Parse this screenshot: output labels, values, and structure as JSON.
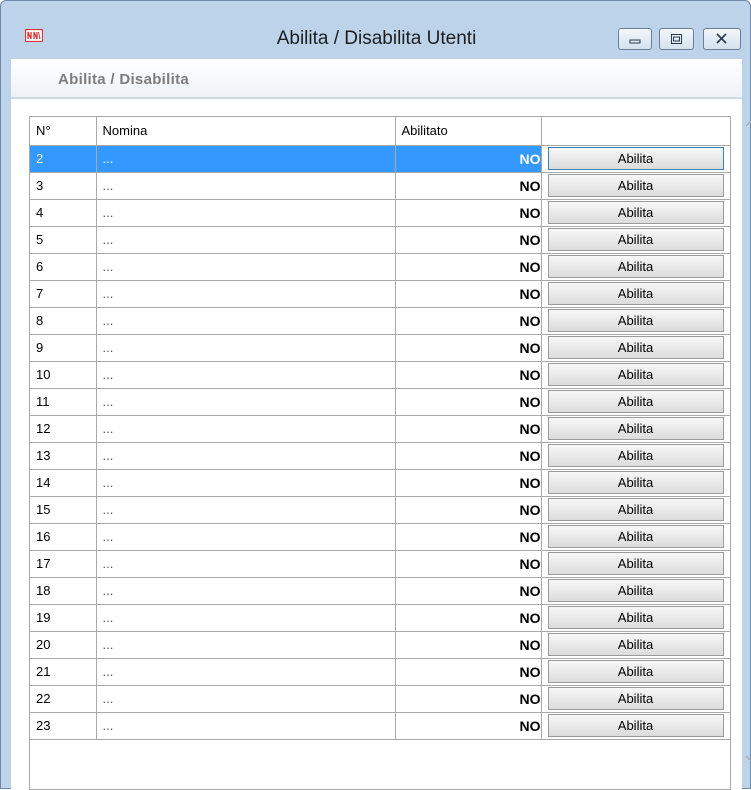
{
  "window": {
    "title": "Abilita / Disabilita Utenti",
    "app_icon": "nn-app-icon",
    "controls": [
      "minimize-icon",
      "restore-icon",
      "close-icon"
    ]
  },
  "section": {
    "title": "Abilita / Disabilita"
  },
  "table": {
    "columns": [
      "N°",
      "Nomina",
      "Abilitato",
      ""
    ],
    "selected_row": 0,
    "rows": [
      {
        "n": "2",
        "nome": "...",
        "abilitato": "NO",
        "azione": "Abilita"
      },
      {
        "n": "3",
        "nome": "...",
        "abilitato": "NO",
        "azione": "Abilita"
      },
      {
        "n": "4",
        "nome": "...",
        "abilitato": "NO",
        "azione": "Abilita"
      },
      {
        "n": "5",
        "nome": "...",
        "abilitato": "NO",
        "azione": "Abilita"
      },
      {
        "n": "6",
        "nome": "...",
        "abilitato": "NO",
        "azione": "Abilita"
      },
      {
        "n": "7",
        "nome": "...",
        "abilitato": "NO",
        "azione": "Abilita"
      },
      {
        "n": "8",
        "nome": "...",
        "abilitato": "NO",
        "azione": "Abilita"
      },
      {
        "n": "9",
        "nome": "...",
        "abilitato": "NO",
        "azione": "Abilita"
      },
      {
        "n": "10",
        "nome": "...",
        "abilitato": "NO",
        "azione": "Abilita"
      },
      {
        "n": "11",
        "nome": "...",
        "abilitato": "NO",
        "azione": "Abilita"
      },
      {
        "n": "12",
        "nome": "...",
        "abilitato": "NO",
        "azione": "Abilita"
      },
      {
        "n": "13",
        "nome": "...",
        "abilitato": "NO",
        "azione": "Abilita"
      },
      {
        "n": "14",
        "nome": "...",
        "abilitato": "NO",
        "azione": "Abilita"
      },
      {
        "n": "15",
        "nome": "...",
        "abilitato": "NO",
        "azione": "Abilita"
      },
      {
        "n": "16",
        "nome": "...",
        "abilitato": "NO",
        "azione": "Abilita"
      },
      {
        "n": "17",
        "nome": "...",
        "abilitato": "NO",
        "azione": "Abilita"
      },
      {
        "n": "18",
        "nome": "...",
        "abilitato": "NO",
        "azione": "Abilita"
      },
      {
        "n": "19",
        "nome": "...",
        "abilitato": "NO",
        "azione": "Abilita"
      },
      {
        "n": "20",
        "nome": "...",
        "abilitato": "NO",
        "azione": "Abilita"
      },
      {
        "n": "21",
        "nome": "...",
        "abilitato": "NO",
        "azione": "Abilita"
      },
      {
        "n": "22",
        "nome": "...",
        "abilitato": "NO",
        "azione": "Abilita"
      },
      {
        "n": "23",
        "nome": "...",
        "abilitato": "NO",
        "azione": "Abilita"
      }
    ]
  },
  "scrollbar": {
    "up": "chevron-up-icon",
    "down": "chevron-down-icon"
  },
  "colors": {
    "selection": "#3399ff",
    "frame": "#bcd3ea",
    "grid_line": "#a9a9a9"
  }
}
